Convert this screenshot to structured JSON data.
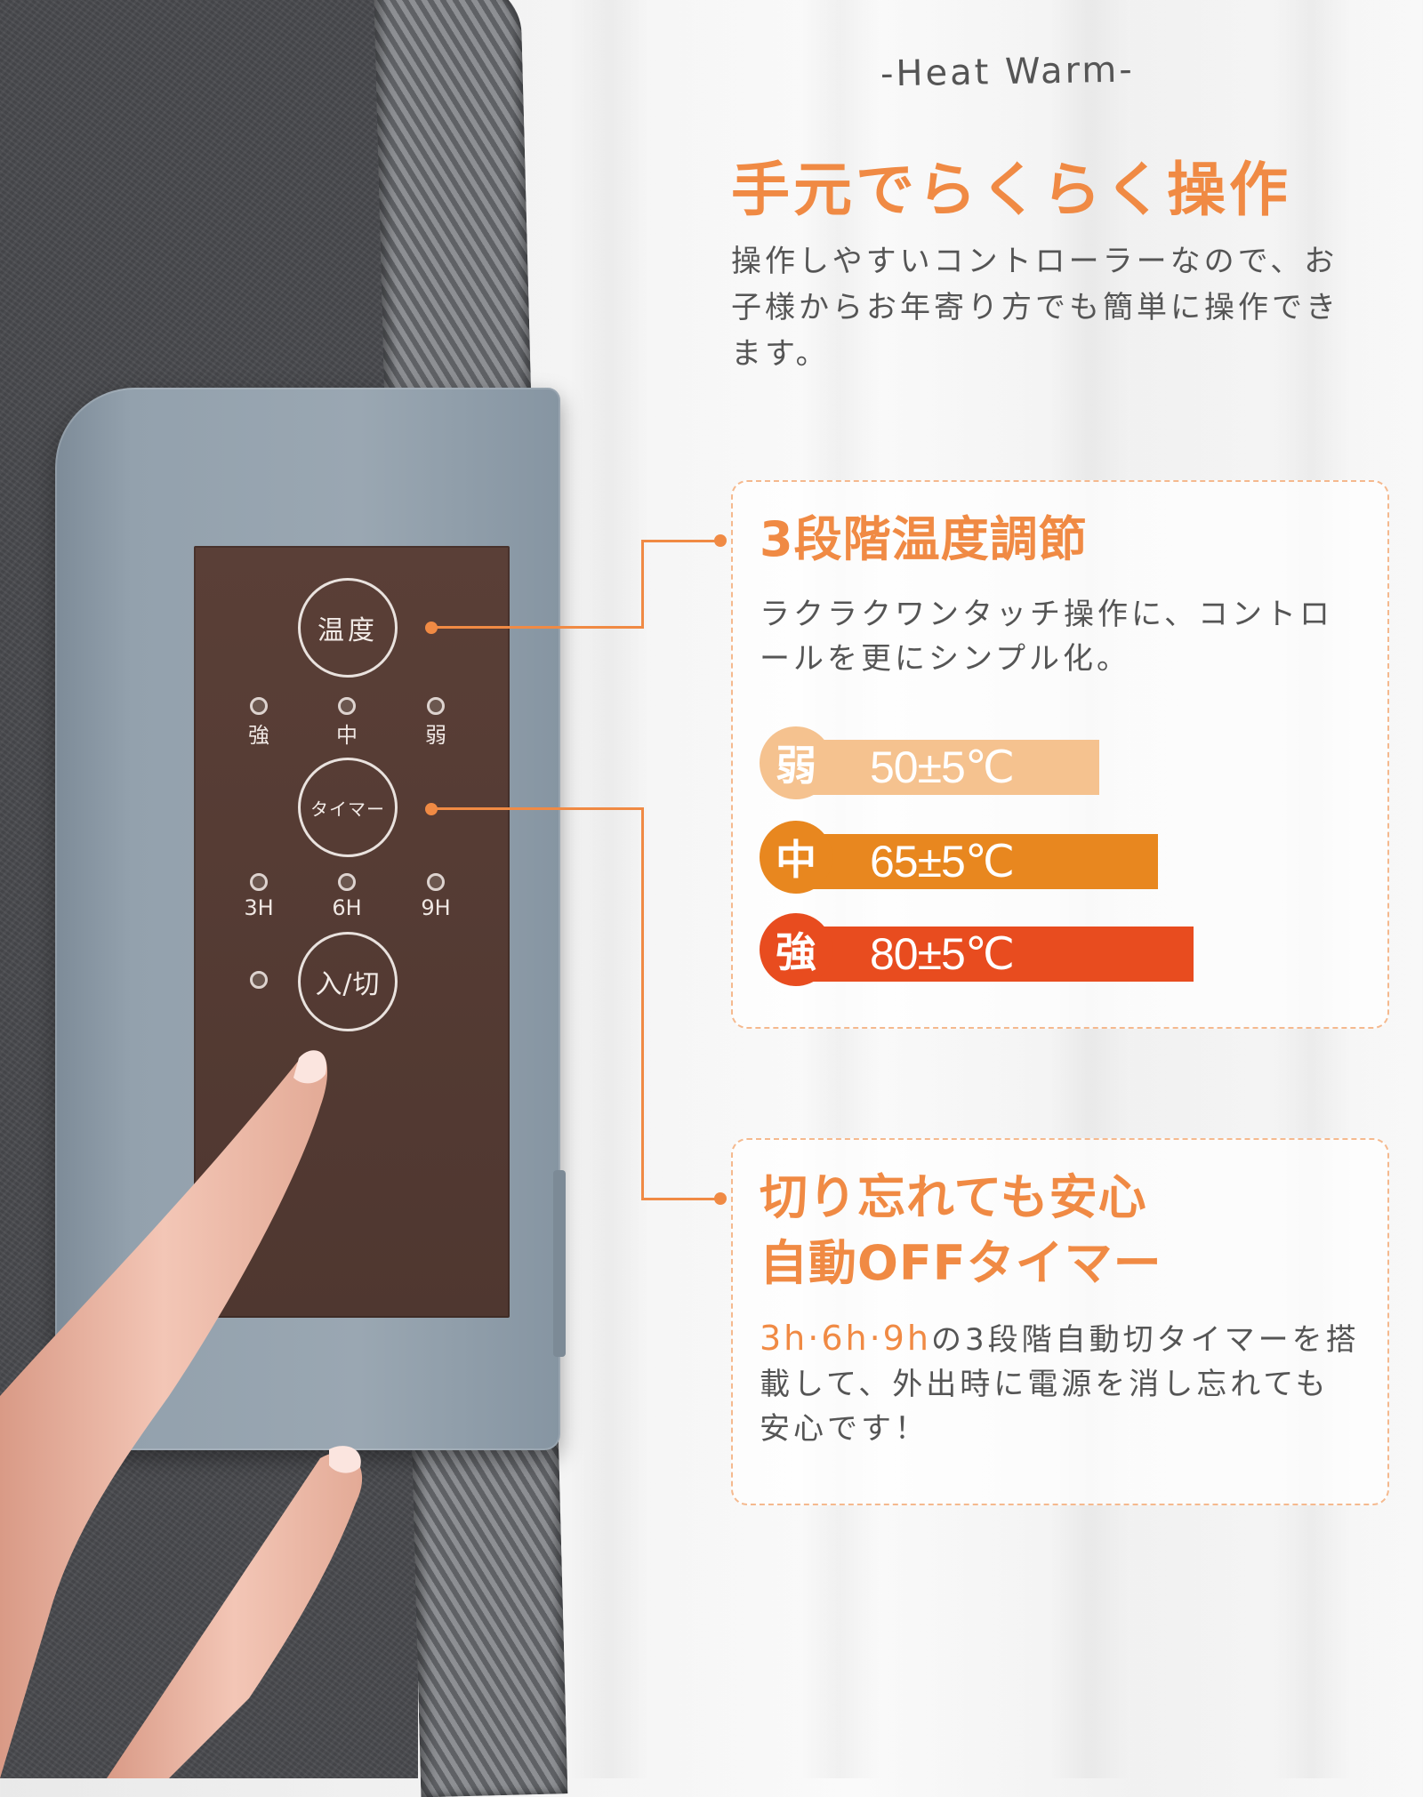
{
  "header": {
    "eyebrow": "-Heat Warm-",
    "title": "手元でらくらく操作",
    "description": "操作しやすいコントローラーなので、お子様からお年寄り方でも簡単に操作できます。"
  },
  "controller": {
    "temp_button": "温度",
    "temp_levels": [
      "強",
      "中",
      "弱"
    ],
    "timer_button": "タイマー",
    "timer_options": [
      "3H",
      "6H",
      "9H"
    ],
    "power_button": "入/切"
  },
  "feature_temperature": {
    "title": "3段階温度調節",
    "text": "ラクラクワンタッチ操作に、コントロールを更にシンプル化。",
    "levels": [
      {
        "name": "弱",
        "temp": "50±5℃",
        "color": "#f5c28f"
      },
      {
        "name": "中",
        "temp": "65±5℃",
        "color": "#e8871f"
      },
      {
        "name": "強",
        "temp": "80±5℃",
        "color": "#e84c1f"
      }
    ]
  },
  "feature_timer": {
    "title_line1": "切り忘れても安心",
    "title_line2": "自動OFFタイマー",
    "highlight": "3h·6h·9h",
    "text": "の3段階自動切タイマーを搭載して、外出時に電源を消し忘れても安心です！"
  },
  "colors": {
    "accent": "#f08a44",
    "panel": "#553b33",
    "controller": "#93a1ad"
  }
}
